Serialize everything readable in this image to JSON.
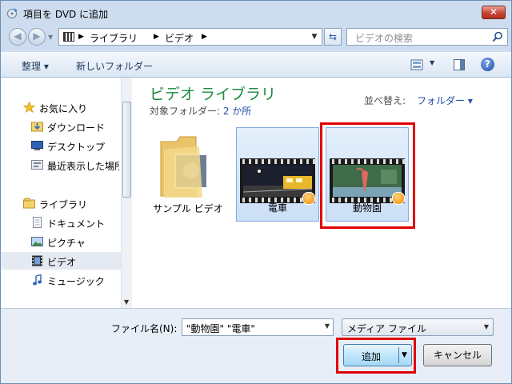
{
  "window": {
    "title": "項目を DVD に追加",
    "close_label": "✕"
  },
  "navbar": {
    "breadcrumbs": [
      "ライブラリ",
      "ビデオ"
    ],
    "search_placeholder": "ビデオの検索"
  },
  "toolbar": {
    "organize_label": "整理 ▾",
    "new_folder_label": "新しいフォルダー"
  },
  "sidebar": {
    "items": [
      {
        "label": "お気に入り",
        "icon": "star-icon"
      },
      {
        "label": "ダウンロード",
        "icon": "download-folder-icon"
      },
      {
        "label": "デスクトップ",
        "icon": "desktop-icon"
      },
      {
        "label": "最近表示した場所",
        "icon": "recent-places-icon"
      },
      {
        "label": "ライブラリ",
        "icon": "library-icon"
      },
      {
        "label": "ドキュメント",
        "icon": "document-icon"
      },
      {
        "label": "ピクチャ",
        "icon": "picture-icon"
      },
      {
        "label": "ビデオ",
        "icon": "video-icon",
        "selected": true
      },
      {
        "label": "ミュージック",
        "icon": "music-icon"
      }
    ]
  },
  "content": {
    "library_title": "ビデオ ライブラリ",
    "subtitle_prefix": "対象フォルダー: ",
    "subtitle_link": "2 か所",
    "sort_label": "並べ替え:",
    "sort_value": "フォルダー ▾",
    "items": [
      {
        "label": "サンプル ビデオ",
        "type": "folder"
      },
      {
        "label": "電車",
        "type": "video",
        "selected": true
      },
      {
        "label": "動物園",
        "type": "video",
        "selected": true
      }
    ]
  },
  "footer": {
    "filename_label": "ファイル名(N):",
    "filename_value": "\"動物園\" \"電車\"",
    "filetype_value": "メディア ファイル",
    "add_label": "追加",
    "cancel_label": "キャンセル"
  },
  "colors": {
    "library_title": "#1e8a3f",
    "highlight_box": "#e00000",
    "link": "#1e4ea8"
  }
}
